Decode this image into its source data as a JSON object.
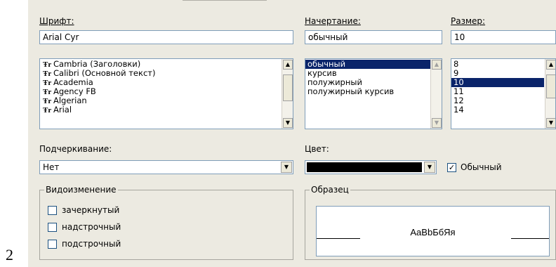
{
  "page_number": "2",
  "font": {
    "label": "Шрифт:",
    "value": "Arial Cyr",
    "items": [
      "Cambria (Заголовки)",
      "Calibri (Основной текст)",
      "Academia",
      "Agency FB",
      "Algerian",
      "Arial"
    ],
    "item_icon": "truetype-icon",
    "item_icon_glyph": "Ŧr"
  },
  "style": {
    "label": "Начертание:",
    "value": "обычный",
    "items": [
      "обычный",
      "курсив",
      "полужирный",
      "полужирный курсив"
    ],
    "selected": "обычный"
  },
  "size": {
    "label": "Размер:",
    "value": "10",
    "items": [
      "8",
      "9",
      "10",
      "11",
      "12",
      "14"
    ],
    "selected": "10"
  },
  "underline": {
    "label": "Подчеркивание:",
    "value": "Нет"
  },
  "color": {
    "label": "Цвет:",
    "swatch": "#000000"
  },
  "normal_font": {
    "label": "Обычный",
    "checked": true,
    "check_glyph": "✓"
  },
  "effects": {
    "title": "Видоизменение",
    "items": [
      {
        "label": "зачеркнутый",
        "checked": false
      },
      {
        "label": "надстрочный",
        "checked": false
      },
      {
        "label": "подстрочный",
        "checked": false
      }
    ]
  },
  "preview": {
    "title": "Образец",
    "sample_text": "AaBbБбЯя"
  },
  "icons": {
    "scroll_up": "▲",
    "scroll_down": "▼",
    "dropdown": "▼"
  },
  "colors": {
    "dialog_bg": "#eceae1",
    "selection_bg": "#0a246a",
    "field_border": "#7f9db9"
  }
}
